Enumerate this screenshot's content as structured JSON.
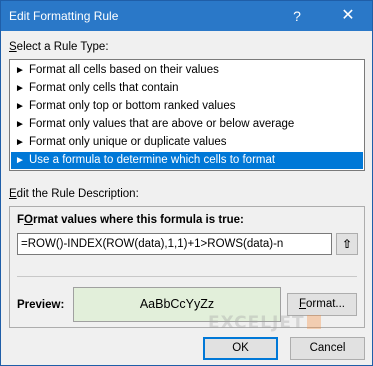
{
  "window": {
    "title": "Edit Formatting Rule",
    "help_glyph": "?",
    "close_glyph": "✕"
  },
  "rule_type": {
    "label_prefix": "",
    "label_hotkey": "S",
    "label_rest": "elect a Rule Type:",
    "items": [
      {
        "label": "Format all cells based on their values",
        "selected": false
      },
      {
        "label": "Format only cells that contain",
        "selected": false
      },
      {
        "label": "Format only top or bottom ranked values",
        "selected": false
      },
      {
        "label": "Format only values that are above or below average",
        "selected": false
      },
      {
        "label": "Format only unique or duplicate values",
        "selected": false
      },
      {
        "label": "Use a formula to determine which cells to format",
        "selected": true
      }
    ]
  },
  "description": {
    "label_hotkey": "E",
    "label_rest": "dit the Rule Description:",
    "formula_label_hotkey": "O",
    "formula_label_pre": "F",
    "formula_label_rest": "rmat values where this formula is true:",
    "formula_value": "=ROW()-INDEX(ROW(data),1,1)+1>ROWS(data)-n",
    "collapse_glyph": "⇧",
    "preview_label": "Preview:",
    "preview_text": "AaBbCcYyZz",
    "format_button_hotkey": "F",
    "format_button_rest": "ormat..."
  },
  "footer": {
    "ok_label": "OK",
    "cancel_label": "Cancel"
  },
  "watermark": {
    "text": "EXCELJET"
  },
  "colors": {
    "titlebar": "#2a78c8",
    "selection": "#0078d7",
    "preview_fill": "#e2efda"
  }
}
